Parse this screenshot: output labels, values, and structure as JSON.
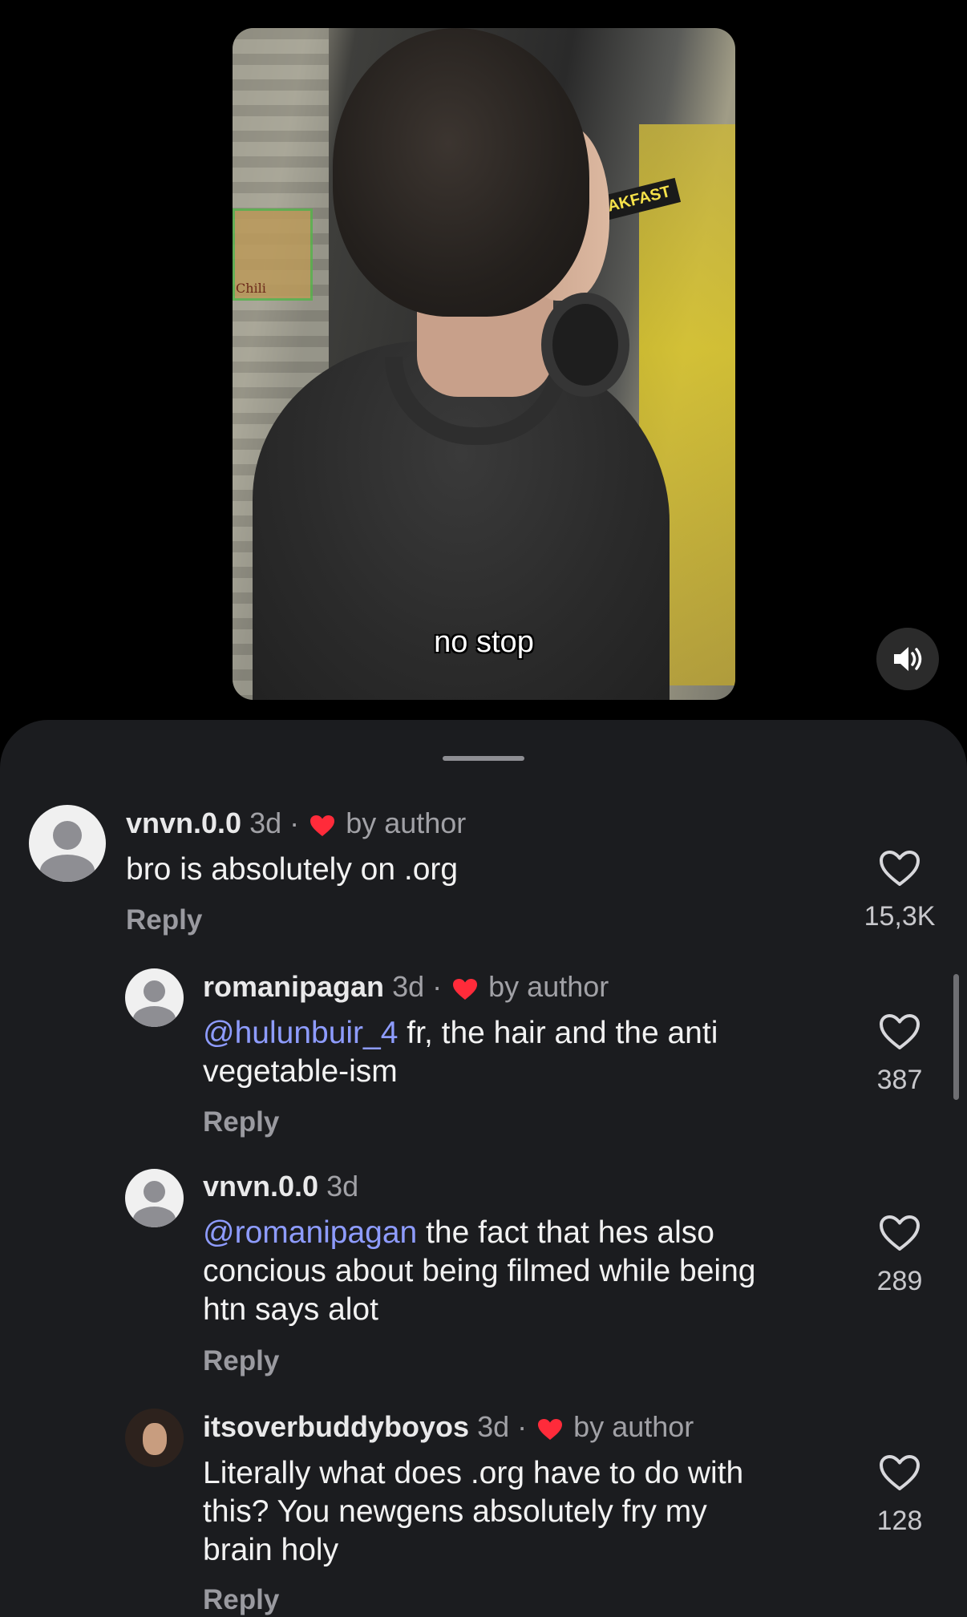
{
  "video": {
    "caption": "no stop",
    "shelf_label": "Chili",
    "aisle_sign": "EAKFAST",
    "mute_icon": "speaker-icon"
  },
  "comments": [
    {
      "user": "vnvn.0.0",
      "time": "3d",
      "liked_by_author": true,
      "by_author_label": "by author",
      "mention": "",
      "text": "bro is absolutely on .org",
      "reply_label": "Reply",
      "likes": "15,3K"
    },
    {
      "user": "romanipagan",
      "time": "3d",
      "liked_by_author": true,
      "by_author_label": "by author",
      "mention": "@hulunbuir_4",
      "text_line1": " fr, the hair and the anti",
      "text_line2": "vegetable-ism",
      "reply_label": "Reply",
      "likes": "387"
    },
    {
      "user": "vnvn.0.0",
      "time": "3d",
      "liked_by_author": false,
      "mention": "@romanipagan",
      "text_line1": " the fact that hes also",
      "text_line2": "concious about being filmed while being",
      "text_line3": "htn says alot",
      "reply_label": "Reply",
      "likes": "289"
    },
    {
      "user": "itsoverbuddyboyos",
      "time": "3d",
      "liked_by_author": true,
      "by_author_label": "by author",
      "text_line1": "Literally what does .org have to do with",
      "text_line2": "this? You newgens absolutely fry my",
      "text_line3": "brain holy",
      "reply_label": "Reply",
      "likes": "128"
    }
  ],
  "colors": {
    "sheet_bg": "#1b1c1f",
    "mention": "#8e9cff",
    "heart_red": "#ff2b3a",
    "muted_text": "#a1a1a6"
  }
}
